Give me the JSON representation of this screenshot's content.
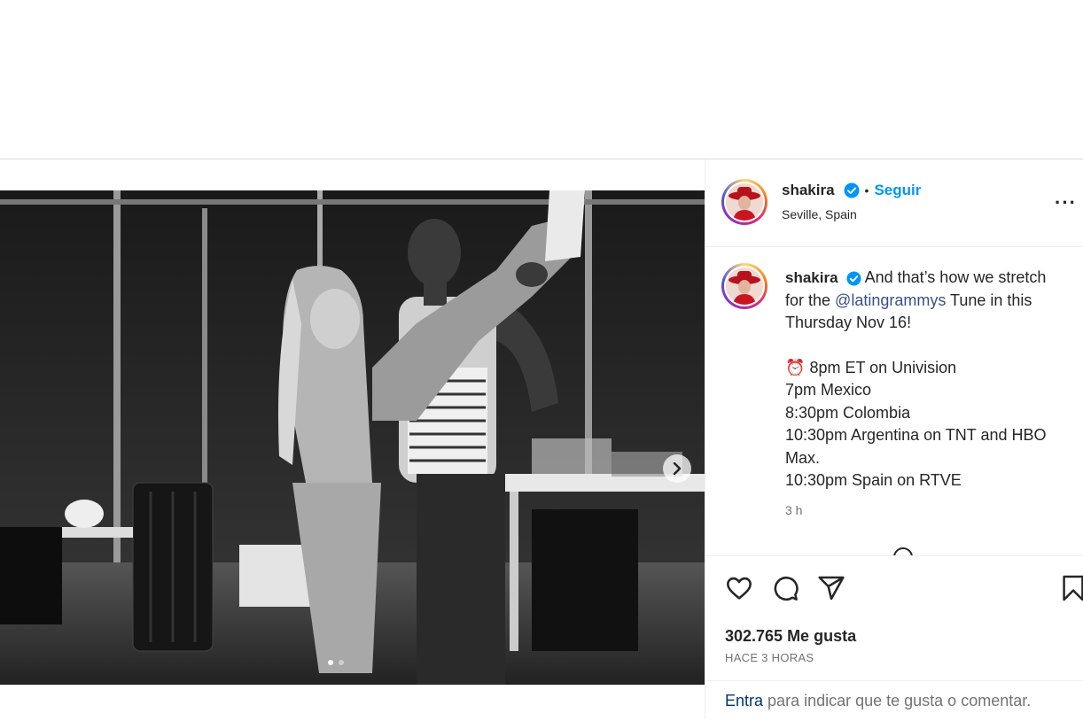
{
  "post": {
    "author": {
      "username": "shakira",
      "verified": true,
      "location": "Seville, Spain",
      "separator": "•",
      "follow_label": "Seguir",
      "more_label": "···"
    },
    "caption": {
      "username": "shakira",
      "text_before_mention": "And that’s how we stretch for the",
      "mention": "@latingrammys",
      "text_after_mention": "Tune in this Thursday Nov 16!",
      "schedule": [
        {
          "icon": "alarm-clock-icon",
          "text": "⏰",
          "label": "8pm ET on Univision"
        },
        {
          "label": "7pm Mexico"
        },
        {
          "label": "8:30pm Colombia"
        },
        {
          "label": "10:30pm Argentina on TNT and HBO Max."
        },
        {
          "label": "10:30pm Spain on RTVE"
        }
      ],
      "time": "3 h"
    },
    "media": {
      "carousel_count": 2,
      "active_index": 0
    },
    "likes": "302.765 Me gusta",
    "posted_ago": "HACE 3 HORAS",
    "login_prompt": {
      "link": "Entra",
      "rest": "para indicar que te gusta o comentar."
    }
  },
  "colors": {
    "accent": "#0095f6",
    "text": "#262626",
    "secondary": "#737373",
    "mention": "#00376b"
  }
}
